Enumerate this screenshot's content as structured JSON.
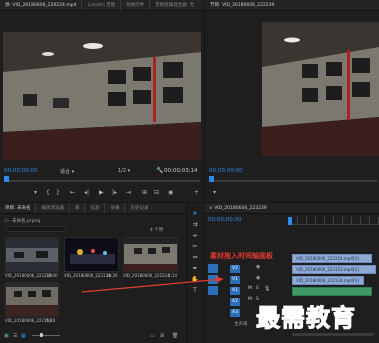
{
  "source_panel": {
    "tabs": [
      "源: VID_20180606_220224.mp4",
      "Lumetri 范围",
      "效果控件",
      "音频剪辑混合器: 无"
    ],
    "timecode_in": "00;00;00;00",
    "fit": "适合",
    "zoom": "1/2",
    "timecode_out": "00;00;03;14"
  },
  "program_panel": {
    "title": "节目: VID_20180606_222239",
    "timecode": "00;00;00;00"
  },
  "project_panel": {
    "tabs": [
      "项目: 未命名",
      "媒体浏览器",
      "库",
      "信息",
      "效果",
      "历史记录"
    ],
    "project_file": "未命名.prproj",
    "item_count": "4 个项",
    "clips": [
      {
        "name": "VID_20180606_222239",
        "duration": "13;00"
      },
      {
        "name": "VID_20180606_222134",
        "duration": "19;26"
      },
      {
        "name": "VID_20180606_222224",
        "duration": "3;14"
      },
      {
        "name": "VID_20180606_222153",
        "duration": "9;28"
      }
    ]
  },
  "timeline_panel": {
    "title": "× VID_20180606_222239",
    "timecode": "00;00;00;00",
    "annotation": "素材拖入时间轴面板",
    "tracks": [
      "V3",
      "V2",
      "V1",
      "A1",
      "A2",
      "A3"
    ],
    "clips": [
      "VID_20180606_222224.mp4[V]",
      "VID_20180606_222153.mp4[V]",
      "VID_20180606_222134.mp4[V]"
    ],
    "master": "主声道"
  },
  "watermark": "最需教育",
  "colors": {
    "accent": "#2d8ceb",
    "annotation": "#e33b2e",
    "clip": "#8fa9d6",
    "audio_clip": "#3f9a6a"
  }
}
